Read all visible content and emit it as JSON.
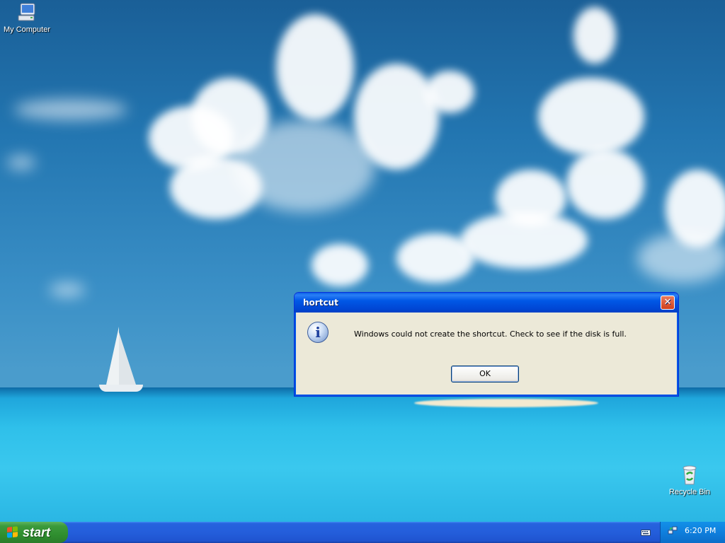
{
  "desktop": {
    "icons": [
      {
        "label": "My Computer",
        "icon": "my-computer-icon"
      },
      {
        "label": "Recycle Bin",
        "icon": "recycle-bin-icon"
      }
    ]
  },
  "dialog": {
    "title": "hortcut",
    "close_label": "✕",
    "icon": "information-icon",
    "message": "Windows could not create the shortcut. Check to see if the disk is full.",
    "ok_label": "OK"
  },
  "taskbar": {
    "start_label": "start",
    "tray": {
      "time": "6:20 PM"
    }
  },
  "colors": {
    "titlebar": "#0058e6",
    "start_green": "#3c9a3c",
    "dialog_face": "#ece9d8",
    "taskbar_blue": "#245edb"
  }
}
